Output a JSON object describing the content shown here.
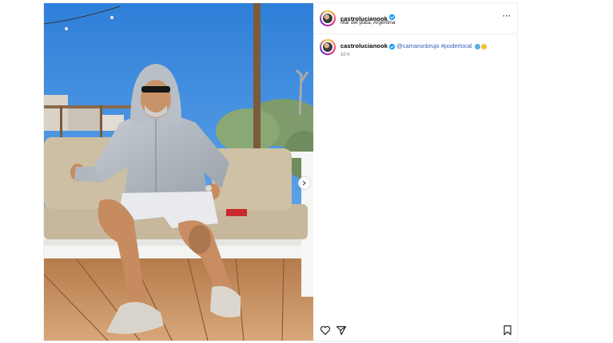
{
  "header": {
    "username": "castrolucianook",
    "location": "Mar del plata, Argentina",
    "more_label": "···"
  },
  "caption": {
    "username": "castrolucianook",
    "mention": "@camaronbrujo",
    "hashtag": "#poderlocal",
    "timestamp": "10 h"
  },
  "icons": {
    "verified": "verified-badge-icon",
    "like": "heart-icon",
    "share": "paper-plane-icon",
    "save": "bookmark-icon",
    "next": "chevron-right-icon"
  },
  "colors": {
    "verified": "#0095f6",
    "link": "#2f5fb8",
    "muted": "#737373"
  }
}
